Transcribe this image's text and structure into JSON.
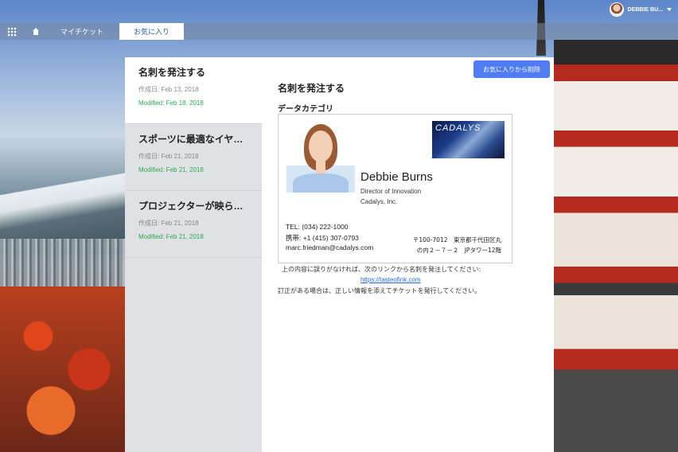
{
  "header": {
    "user_name": "DEBBIE BU...",
    "avatar_icon": "user-avatar"
  },
  "nav": {
    "app_launcher_icon": "app-grid-icon",
    "home_icon": "home-icon",
    "tabs": [
      {
        "label": "マイチケット",
        "active": false
      },
      {
        "label": "お気に入り",
        "active": true
      }
    ]
  },
  "list": {
    "items": [
      {
        "title": "名刺を発注する",
        "created": "作成日: Feb 13, 2018",
        "modified": "Modified: Feb 18, 2018",
        "selected": true
      },
      {
        "title": "スポーツに最適なイヤホン",
        "created": "作成日: Feb 21, 2018",
        "modified": "Modified: Feb 21, 2018",
        "selected": false
      },
      {
        "title": "プロジェクターが映らない…",
        "created": "作成日: Feb 21, 2018",
        "modified": "Modified: Feb 21, 2018",
        "selected": false
      }
    ]
  },
  "detail": {
    "remove_button": "お気に入りから削除",
    "title": "名刺を発注する",
    "category_label": "データカテゴリ",
    "card": {
      "logo_text": "CADALYS",
      "name": "Debbie Burns",
      "role": "Director of Innovation",
      "company": "Cadalys, Inc.",
      "tel": "TEL: (034) 222-1000",
      "mobile": "携帯: +1 (415) 307-0793",
      "email": "marc.friedman@cadalys.com",
      "address_line1": "〒100-7012　東京都千代田区丸",
      "address_line2": "の内２－７－２　JPタワー12階"
    },
    "note1": "上の内容に誤りがなければ、次のリンクから名刺を発注してください:",
    "link": "https://tasteofink.com",
    "note2": "訂正がある場合は、正しい情報を添えてチケットを発行してください。"
  },
  "colors": {
    "accent_button": "#4f7cf2",
    "modified_text": "#2fa84f",
    "active_tab_text": "#2a5db0",
    "link": "#2a6ad8"
  }
}
